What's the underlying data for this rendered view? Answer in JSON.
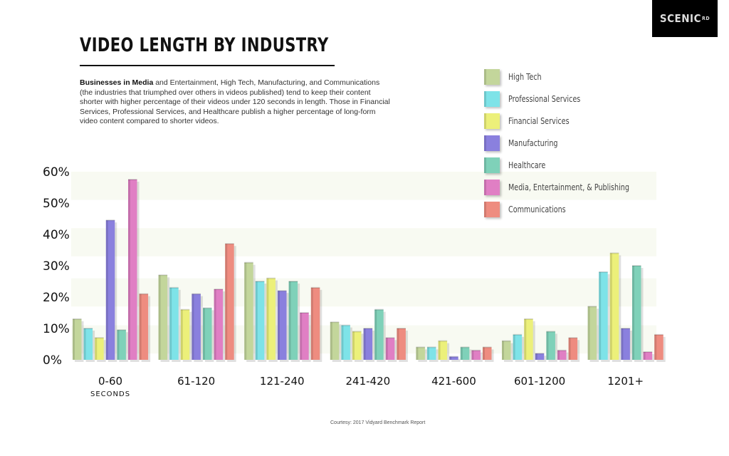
{
  "brand": {
    "logo": "SCENIC",
    "logo_sup": "RD"
  },
  "title": "VIDEO LENGTH BY INDUSTRY",
  "description": {
    "bold": "Businesses in Media",
    "rest": " and Entertainment, High Tech, Manufacturing, and Communications (the industries that triumphed over others in videos published) tend to keep their content shorter with higher percentage of their videos under 120 seconds in length. Those in Financial Services, Professional Services, and Healthcare publish a higher percentage of long-form video content compared to shorter videos."
  },
  "credit": "Courtesy:  2017 Vidyard Benchmark Report",
  "chart_data": {
    "type": "bar",
    "title": "VIDEO LENGTH BY INDUSTRY",
    "xlabel": "",
    "x_sublabel": "SECONDS",
    "ylabel": "",
    "ylim": [
      0,
      60
    ],
    "yticks": [
      "0%",
      "10%",
      "20%",
      "30%",
      "40%",
      "50%",
      "60%"
    ],
    "categories": [
      "0-60",
      "61-120",
      "121-240",
      "241-420",
      "421-600",
      "601-1200",
      "1201+"
    ],
    "legend_position": "top-right",
    "grid": "alternating horizontal bands",
    "series": [
      {
        "name": "High Tech",
        "color": "#c3d69b",
        "values": [
          13,
          27,
          31,
          12,
          4,
          6,
          17
        ]
      },
      {
        "name": "Professional Services",
        "color": "#7ee3e8",
        "values": [
          10,
          23,
          25,
          11,
          4,
          8,
          28
        ]
      },
      {
        "name": "Financial Services",
        "color": "#ecf07a",
        "values": [
          7,
          16,
          26,
          9,
          6,
          13,
          34
        ]
      },
      {
        "name": "Manufacturing",
        "color": "#8a80de",
        "values": [
          44.5,
          21,
          22,
          10,
          1,
          2,
          10
        ]
      },
      {
        "name": "Healthcare",
        "color": "#7fd1b9",
        "values": [
          9.5,
          16.5,
          25,
          16,
          4,
          9,
          30
        ]
      },
      {
        "name": "Media, Entertainment, & Publishing",
        "color": "#e07fc4",
        "values": [
          57.5,
          22.5,
          15,
          7,
          3,
          3,
          2.5
        ]
      },
      {
        "name": "Communications",
        "color": "#ee8c80",
        "values": [
          21,
          37,
          23,
          10,
          4,
          7,
          8
        ]
      }
    ]
  }
}
